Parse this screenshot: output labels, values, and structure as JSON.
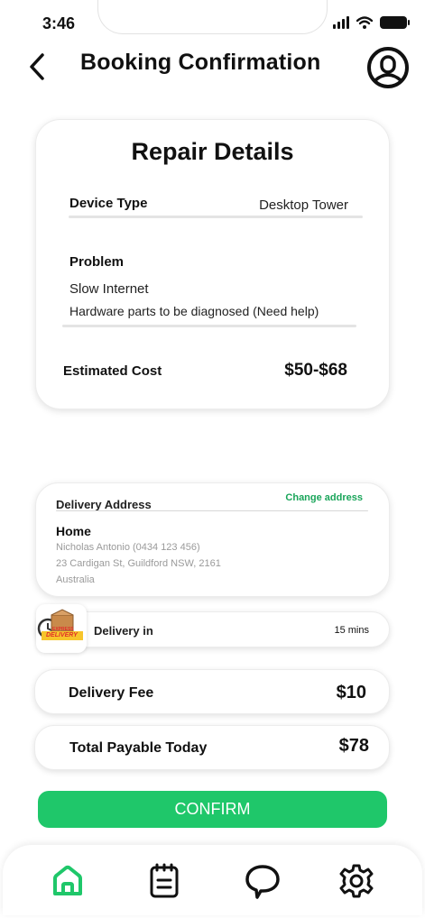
{
  "status_bar": {
    "time": "3:46"
  },
  "header": {
    "title": "Booking Confirmation",
    "back_icon": "chevron-left-icon",
    "profile_icon": "user-circle-icon"
  },
  "repair_details": {
    "title": "Repair Details",
    "device_type_label": "Device Type",
    "device_type_value": "Desktop Tower",
    "problem_label": "Problem",
    "problem_line1": "Slow Internet",
    "problem_line2": "Hardware parts to be diagnosed (Need help)",
    "estimated_cost_label": "Estimated Cost",
    "estimated_cost_value": "$50-$68"
  },
  "delivery_address": {
    "label": "Delivery Address",
    "change_link": "Change address",
    "place_name": "Home",
    "contact": "Nicholas Antonio (0434 123 456)",
    "street": "23 Cardigan St, Guildford NSW, 2161",
    "country": "Australia"
  },
  "delivery_in": {
    "label": "Delivery in",
    "value": "15 mins",
    "badge_top": "EXPRESS",
    "badge_bottom": "DELIVERY"
  },
  "delivery_fee": {
    "label": "Delivery Fee",
    "value": "$10"
  },
  "total": {
    "label": "Total Payable Today",
    "value": "$78"
  },
  "confirm_button": "CONFIRM",
  "bottom_nav": {
    "items": [
      {
        "icon": "home-icon",
        "active": true
      },
      {
        "icon": "clipboard-icon",
        "active": false
      },
      {
        "icon": "chat-bubble-icon",
        "active": false
      },
      {
        "icon": "gear-icon",
        "active": false
      }
    ]
  },
  "colors": {
    "accent": "#1fc76a",
    "link": "#1aa55a",
    "text": "#111111",
    "muted": "#9a9a9a"
  }
}
